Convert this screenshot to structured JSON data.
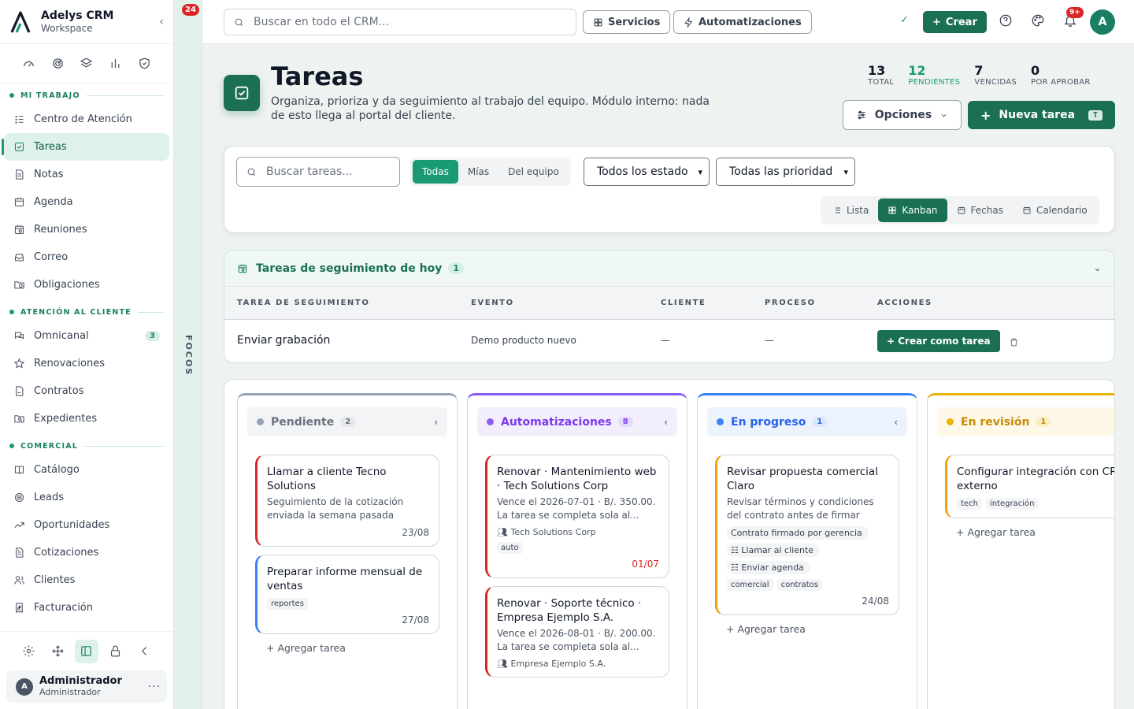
{
  "brand": {
    "name": "Adelys CRM",
    "sub": "Workspace"
  },
  "sidebar": {
    "sections": [
      {
        "label": "MI TRABAJO",
        "items": [
          {
            "label": "Centro de Atención",
            "icon": "list-check-icon"
          },
          {
            "label": "Tareas",
            "icon": "checkbox-icon",
            "active": true
          },
          {
            "label": "Notas",
            "icon": "note-icon"
          },
          {
            "label": "Agenda",
            "icon": "calendar-icon"
          },
          {
            "label": "Reuniones",
            "icon": "calendar-clock-icon"
          },
          {
            "label": "Correo",
            "icon": "inbox-icon"
          },
          {
            "label": "Obligaciones",
            "icon": "folder-clock-icon"
          }
        ]
      },
      {
        "label": "ATENCIÓN AL CLIENTE",
        "items": [
          {
            "label": "Omnicanal",
            "icon": "chat-icon",
            "badge": "3"
          },
          {
            "label": "Renovaciones",
            "icon": "star-icon"
          },
          {
            "label": "Contratos",
            "icon": "file-sign-icon"
          },
          {
            "label": "Expedientes",
            "icon": "folder-search-icon"
          }
        ]
      },
      {
        "label": "COMERCIAL",
        "items": [
          {
            "label": "Catálogo",
            "icon": "book-icon"
          },
          {
            "label": "Leads",
            "icon": "target-icon"
          },
          {
            "label": "Oportunidades",
            "icon": "trend-icon"
          },
          {
            "label": "Cotizaciones",
            "icon": "document-icon"
          },
          {
            "label": "Clientes",
            "icon": "users-icon"
          },
          {
            "label": "Facturación",
            "icon": "invoice-icon"
          }
        ]
      }
    ],
    "user": {
      "initial": "A",
      "name": "Administrador",
      "role": "Administrador"
    }
  },
  "rail": {
    "badge": "24",
    "label": "FOCOS"
  },
  "topbar": {
    "search_placeholder": "Buscar en todo el CRM...",
    "services_label": "Servicios",
    "automations_label": "Automatizaciones",
    "create_label": "Crear",
    "notif_badge": "9+",
    "avatar": "A"
  },
  "header": {
    "title": "Tareas",
    "description": "Organiza, prioriza y da seguimiento al trabajo del equipo. Módulo interno: nada de esto llega al portal del cliente.",
    "stats": [
      {
        "value": "13",
        "label": "TOTAL"
      },
      {
        "value": "12",
        "label": "PENDIENTES"
      },
      {
        "value": "7",
        "label": "VENCIDAS"
      },
      {
        "value": "0",
        "label": "POR APROBAR"
      }
    ],
    "options_label": "Opciones",
    "new_task_label": "Nueva tarea",
    "new_task_shortcut": "T"
  },
  "filters": {
    "search_placeholder": "Buscar tareas...",
    "scope": [
      "Todas",
      "Mías",
      "Del equipo"
    ],
    "status_select": "Todos los estado",
    "priority_select": "Todas las prioridad",
    "views": [
      "Lista",
      "Kanban",
      "Fechas",
      "Calendario"
    ]
  },
  "followups": {
    "title": "Tareas de seguimiento de hoy",
    "count": "1",
    "columns": [
      "TAREA DE SEGUIMIENTO",
      "EVENTO",
      "CLIENTE",
      "PROCESO",
      "ACCIONES"
    ],
    "rows": [
      {
        "task": "Enviar grabación",
        "event": "Demo producto nuevo",
        "client": "—",
        "process": "—",
        "action": "+ Crear como tarea"
      }
    ]
  },
  "kanban": {
    "add_label": "+ Agregar tarea",
    "columns": [
      {
        "name": "Pendiente",
        "count": "2",
        "color": "#94a3b8",
        "cards": [
          {
            "title": "Llamar a cliente Tecno Solutions",
            "desc": "Seguimiento de la cotización enviada la semana pasada",
            "date": "23/08",
            "accent": "#dc2626"
          },
          {
            "title": "Preparar informe mensual de ventas",
            "tags": [
              "reportes"
            ],
            "date": "27/08",
            "accent": "#3b82f6"
          }
        ]
      },
      {
        "name": "Automatizaciones",
        "count": "8",
        "color": "#8b5cf6",
        "cards": [
          {
            "title": "Renovar · Mantenimiento web · Tech Solutions Corp",
            "desc": "Vence el 2026-07-01 · B/. 350.00. La tarea se completa sola al...",
            "meta": "Tech Solutions Corp",
            "tags": [
              "auto"
            ],
            "date": "01/07",
            "due": true,
            "accent": "#dc2626"
          },
          {
            "title": "Renovar · Soporte técnico · Empresa Ejemplo S.A.",
            "desc": "Vence el 2026-08-01 · B/. 200.00. La tarea se completa sola al...",
            "meta": "Empresa Ejemplo S.A.",
            "accent": "#dc2626"
          }
        ]
      },
      {
        "name": "En progreso",
        "count": "1",
        "color": "#3b82f6",
        "cards": [
          {
            "title": "Revisar propuesta comercial Claro",
            "desc": "Revisar términos y condiciones del contrato antes de firmar",
            "chips": [
              "Contrato firmado por gerencia"
            ],
            "subtasks": [
              "Llamar al cliente",
              "Enviar agenda"
            ],
            "tags": [
              "comercial",
              "contratos"
            ],
            "date": "24/08",
            "accent": "#f59e0b"
          }
        ]
      },
      {
        "name": "En revisión",
        "count": "1",
        "color": "#eab308",
        "cards": [
          {
            "title": "Configurar integración con CRM externo",
            "tags": [
              "tech",
              "integración"
            ],
            "accent": "#f59e0b"
          }
        ]
      }
    ]
  }
}
